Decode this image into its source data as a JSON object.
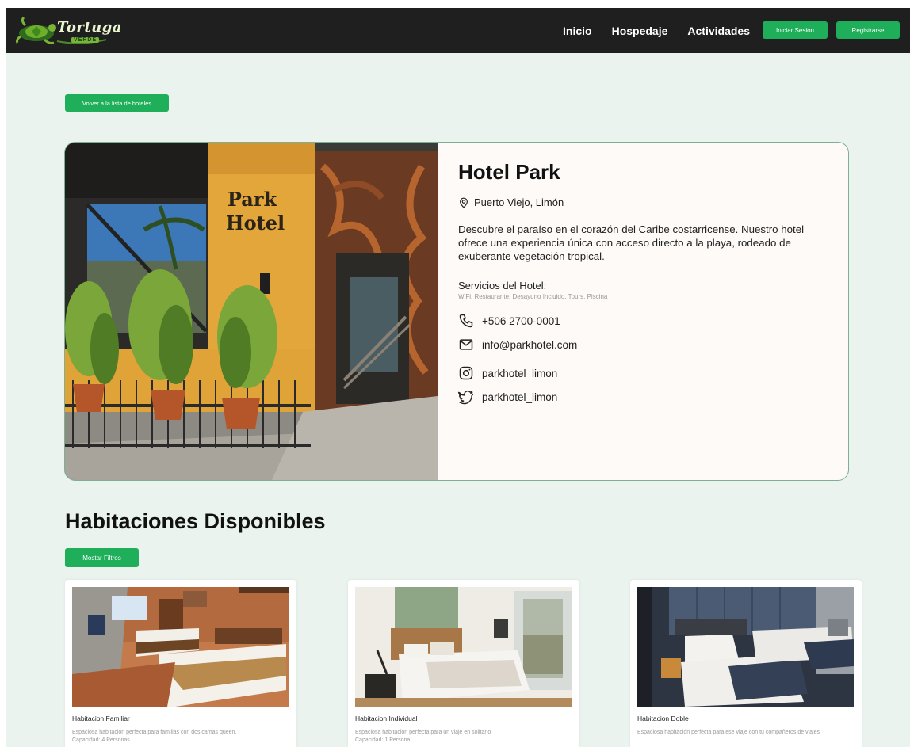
{
  "nav": {
    "logo_text": "Tortuga",
    "logo_sub": "VERDE",
    "links": [
      "Inicio",
      "Hospedaje",
      "Actividades"
    ],
    "login_label": "Iniciar Sesion",
    "register_label": "Registrarse"
  },
  "back_button": "Volver a la lista de hoteles",
  "hotel": {
    "image_sign": [
      "Park",
      "Hotel"
    ],
    "name": "Hotel Park",
    "location": "Puerto Viejo, Limón",
    "description": "Descubre el paraíso en el corazón del Caribe costarricense. Nuestro hotel ofrece una experiencia única con acceso directo a la playa, rodeado de exuberante vegetación tropical.",
    "services_label": "Servicios del Hotel:",
    "services": "WiFi, Restaurante,  Desayuno Incluido, Tours, Piscina",
    "phone": "+506 2700-0001",
    "email": "info@parkhotel.com",
    "instagram": "parkhotel_limon",
    "twitter": "parkhotel_limon"
  },
  "rooms_section": {
    "title": "Habitaciones Disponibles",
    "filters_button": "Mostar Filtros",
    "rooms": [
      {
        "name": "Habitacion Familiar",
        "description": "Espaciosa habitación perfecta para familias con dos camas queen.",
        "capacity": "Capacidad: 4 Personas"
      },
      {
        "name": "Habitacion Individual",
        "description": "Espaciosa habitación perfecta para un viaje en solitario",
        "capacity": "Capacidad: 1 Persona"
      },
      {
        "name": "Habitacion Doble",
        "description": "Espaciosa habitación perfecta para ese viaje con tu compañeros de viajes",
        "capacity": ""
      }
    ]
  },
  "colors": {
    "navbar": "#1f1f1f",
    "accent_green": "#1fae5a",
    "page_bg": "#eaf3ee",
    "card_bg": "#fdfaf8"
  }
}
